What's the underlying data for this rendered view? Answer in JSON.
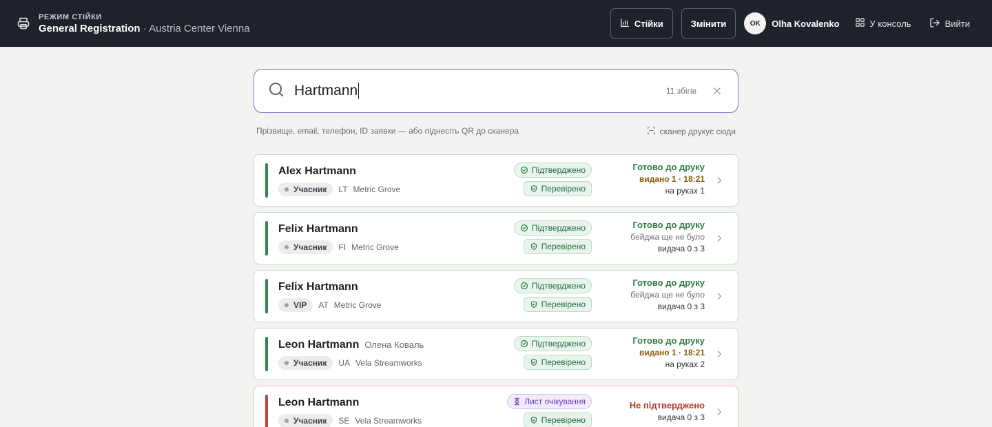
{
  "header": {
    "mode_label": "РЕЖИМ СТІЙКИ",
    "event_title": "General Registration",
    "separator": "·",
    "venue": "Austria Center Vienna",
    "stats_label": "Стійки",
    "change_label": "Змінити",
    "user_initials": "OK",
    "user_name": "Olha Kovalenko",
    "console_label": "У консоль",
    "logout_label": "Вийти"
  },
  "search": {
    "value": "Hartmann",
    "match_count": "11 збігів",
    "hint": "Прізвище, email, телефон, ID заявки — або піднесіть QR до сканера",
    "scanner_hint": "сканер друкує сюди"
  },
  "results": [
    {
      "name": "Alex Hartmann",
      "alt_name": "",
      "role": "Учасник",
      "country": "LT",
      "company": "Metric Grove",
      "badge_top": "Підтверджено",
      "badge_bottom": "Перевірено",
      "status_title": "Готово до друку",
      "status_sub": "видано 1 · 18:21",
      "status_count": "на руках 1"
    },
    {
      "name": "Felix Hartmann",
      "alt_name": "",
      "role": "Учасник",
      "country": "FI",
      "company": "Metric Grove",
      "badge_top": "Підтверджено",
      "badge_bottom": "Перевірено",
      "status_title": "Готово до друку",
      "status_sub": "бейджа ще не було",
      "status_count": "видача 0 з 3"
    },
    {
      "name": "Felix Hartmann",
      "alt_name": "",
      "role": "VIP",
      "country": "AT",
      "company": "Metric Grove",
      "badge_top": "Підтверджено",
      "badge_bottom": "Перевірено",
      "status_title": "Готово до друку",
      "status_sub": "бейджа ще не було",
      "status_count": "видача 0 з 3"
    },
    {
      "name": "Leon Hartmann",
      "alt_name": "Олена Коваль",
      "role": "Учасник",
      "country": "UA",
      "company": "Vela Streamworks",
      "badge_top": "Підтверджено",
      "badge_bottom": "Перевірено",
      "status_title": "Готово до друку",
      "status_sub": "видано 1 · 18:21",
      "status_count": "на руках 2"
    },
    {
      "name": "Leon Hartmann",
      "alt_name": "",
      "role": "Учасник",
      "country": "SE",
      "company": "Vela Streamworks",
      "badge_top": "Лист очікування",
      "badge_bottom": "Перевірено",
      "status_title": "Не підтверджено",
      "status_count": "видача 0 з 3"
    }
  ],
  "colors": {
    "header_bg": "#1d222b",
    "accent_ok": "#2f8a55",
    "accent_warn": "#c0483a",
    "search_border": "#7a6fd6"
  }
}
